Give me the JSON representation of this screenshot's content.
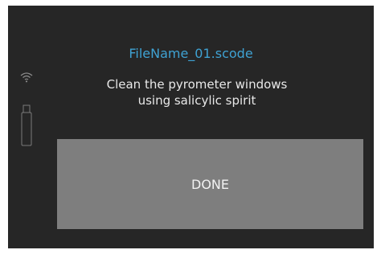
{
  "dialog": {
    "file_name": "FileName_01.scode",
    "message_line1": "Clean the pyrometer windows",
    "message_line2": "using salicylic spirit",
    "done_label": "DONE"
  },
  "status_icons": [
    "wifi-icon",
    "usb-icon"
  ],
  "colors": {
    "background": "#262626",
    "file_name": "#3fa2d3",
    "button": "#7e7e7e",
    "text": "#e8e8e8"
  }
}
